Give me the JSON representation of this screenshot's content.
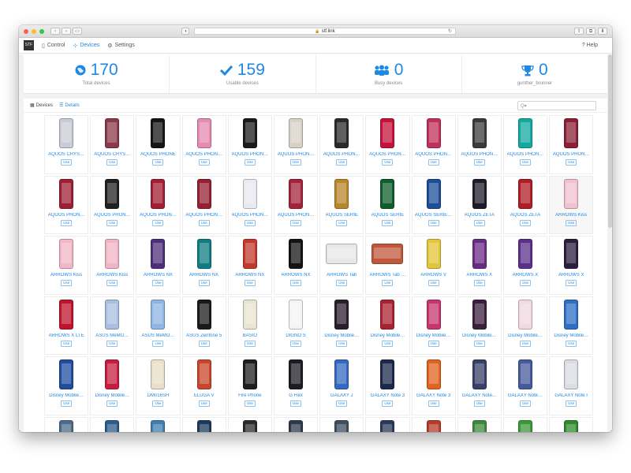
{
  "browser": {
    "url": "stf.link",
    "back_icon": "chevron-left-icon",
    "forward_icon": "chevron-right-icon"
  },
  "nav": {
    "logo_text_1": "STF",
    "logo_text_2": "",
    "control": "Control",
    "devices": "Devices",
    "settings": "Settings",
    "help": "Help"
  },
  "stats": [
    {
      "value": "170",
      "label": "Total devices",
      "icon": "globe-icon"
    },
    {
      "value": "159",
      "label": "Usable devices",
      "icon": "check-icon"
    },
    {
      "value": "0",
      "label": "Busy devices",
      "icon": "users-icon"
    },
    {
      "value": "0",
      "label": "gunther_brunner",
      "icon": "trophy-icon"
    }
  ],
  "tabs": {
    "devices": "Devices",
    "details": "Details"
  },
  "search": {
    "placeholder": "Q▾"
  },
  "use_label": "Use",
  "colors": {
    "accent": "#1e88e5"
  },
  "devices": [
    {
      "name": "AQUOS CRYS…",
      "color": "#c9ccd6"
    },
    {
      "name": "AQUOS CRYS…",
      "color": "#8a3a4a"
    },
    {
      "name": "AQUOS PHONE",
      "color": "#151515"
    },
    {
      "name": "AQUOS PHON…",
      "color": "#e58ab0"
    },
    {
      "name": "AQUOS PHON…",
      "color": "#1a1a1a"
    },
    {
      "name": "AQUOS PHON…",
      "color": "#d8d2c6"
    },
    {
      "name": "AQUOS PHON…",
      "color": "#2a2a2a"
    },
    {
      "name": "AQUOS PHON…",
      "color": "#c4123c"
    },
    {
      "name": "AQUOS PHON…",
      "color": "#c22f5a"
    },
    {
      "name": "AQUOS PHON…",
      "color": "#3a3a3a"
    },
    {
      "name": "AQUOS PHON…",
      "color": "#13a8a0"
    },
    {
      "name": "AQUOS PHON…",
      "color": "#8a1f35"
    },
    {
      "name": "AQUOS PHON…",
      "color": "#9e1f35"
    },
    {
      "name": "AQUOS PHON…",
      "color": "#202020"
    },
    {
      "name": "AQUOS PHON…",
      "color": "#a11e33"
    },
    {
      "name": "AQUOS PHON…",
      "color": "#962033"
    },
    {
      "name": "AQUOS PHON…",
      "color": "#e9e9f2"
    },
    {
      "name": "AQUOS PHON…",
      "color": "#a3243a"
    },
    {
      "name": "AQUOS SERIE",
      "color": "#b8862b"
    },
    {
      "name": "AQUOS SERIE",
      "color": "#0f5c2c"
    },
    {
      "name": "AQUOS SERIE…",
      "color": "#1d4d9a"
    },
    {
      "name": "AQUOS ZETA",
      "color": "#1d1d2a"
    },
    {
      "name": "AQUOS ZETA",
      "color": "#b01d26"
    },
    {
      "name": "ARROWS Kiss",
      "color": "#f0c2d0"
    },
    {
      "name": "ARROWS Kiss",
      "color": "#f2b6c8"
    },
    {
      "name": "ARROWS Kiss",
      "color": "#efb5c5"
    },
    {
      "name": "ARROWS NX",
      "color": "#4f2f7a"
    },
    {
      "name": "ARROWS NX",
      "color": "#0f7d83"
    },
    {
      "name": "ARROWS NX",
      "color": "#c0392b"
    },
    {
      "name": "ARROWS NX",
      "color": "#141414"
    },
    {
      "name": "ARROWS Tab",
      "color": "#e7e7e7",
      "wide": true
    },
    {
      "name": "ARROWS Tab …",
      "color": "#c0573a",
      "wide": true
    },
    {
      "name": "ARROWS V",
      "color": "#e3c53a"
    },
    {
      "name": "ARROWS X",
      "color": "#6a2d84"
    },
    {
      "name": "ARROWS X",
      "color": "#5b2f8a"
    },
    {
      "name": "ARROWS X",
      "color": "#2a1d3d"
    },
    {
      "name": "ARROWS X LTE",
      "color": "#c2132c"
    },
    {
      "name": "ASUS MeMO…",
      "color": "#a9bfe1"
    },
    {
      "name": "ASUS MeMO…",
      "color": "#8fb6e4"
    },
    {
      "name": "ASUS Zenfone 5",
      "color": "#1a1a1a"
    },
    {
      "name": "BASIO",
      "color": "#e8e4d2"
    },
    {
      "name": "DIGNO S",
      "color": "#f4f4f4"
    },
    {
      "name": "Disney Mobile…",
      "color": "#2a1e2c"
    },
    {
      "name": "Disney Mobile…",
      "color": "#a8222f"
    },
    {
      "name": "Disney Mobile…",
      "color": "#c7356f"
    },
    {
      "name": "Disney Mobile…",
      "color": "#3b1f3c"
    },
    {
      "name": "Disney Mobile…",
      "color": "#f2d8e2"
    },
    {
      "name": "Disney Mobile…",
      "color": "#2f6ec6"
    },
    {
      "name": "Disney Mobile…",
      "color": "#1f4da0"
    },
    {
      "name": "Disney Mobile…",
      "color": "#c61d3e"
    },
    {
      "name": "DM016SH",
      "color": "#eadfc9"
    },
    {
      "name": "ELUGA V",
      "color": "#c8462b"
    },
    {
      "name": "Fire Phone",
      "color": "#1e1e1e"
    },
    {
      "name": "G Flex",
      "color": "#1c1c24"
    },
    {
      "name": "GALAXY J",
      "color": "#3568c0"
    },
    {
      "name": "GALAXY Note 3",
      "color": "#1b2a4a"
    },
    {
      "name": "GALAXY Note 3",
      "color": "#e2621f"
    },
    {
      "name": "GALAXY Note…",
      "color": "#3a3f6a"
    },
    {
      "name": "GALAXY Note…",
      "color": "#445a9a"
    },
    {
      "name": "GALAXY Note I",
      "color": "#d9dde3"
    },
    {
      "name": "",
      "color": "#4d6c8a"
    },
    {
      "name": "",
      "color": "#2c5c8a"
    },
    {
      "name": "",
      "color": "#3f7fb0"
    },
    {
      "name": "",
      "color": "#1d3a5c"
    },
    {
      "name": "",
      "color": "#2b2b2b"
    },
    {
      "name": "",
      "color": "#2d3a4e"
    },
    {
      "name": "",
      "color": "#3d4e5e"
    },
    {
      "name": "",
      "color": "#2a3a5a"
    },
    {
      "name": "",
      "color": "#b83a2a"
    },
    {
      "name": "",
      "color": "#3d8a3a"
    },
    {
      "name": "",
      "color": "#3a9a3a"
    },
    {
      "name": "",
      "color": "#2e8a2e"
    }
  ]
}
